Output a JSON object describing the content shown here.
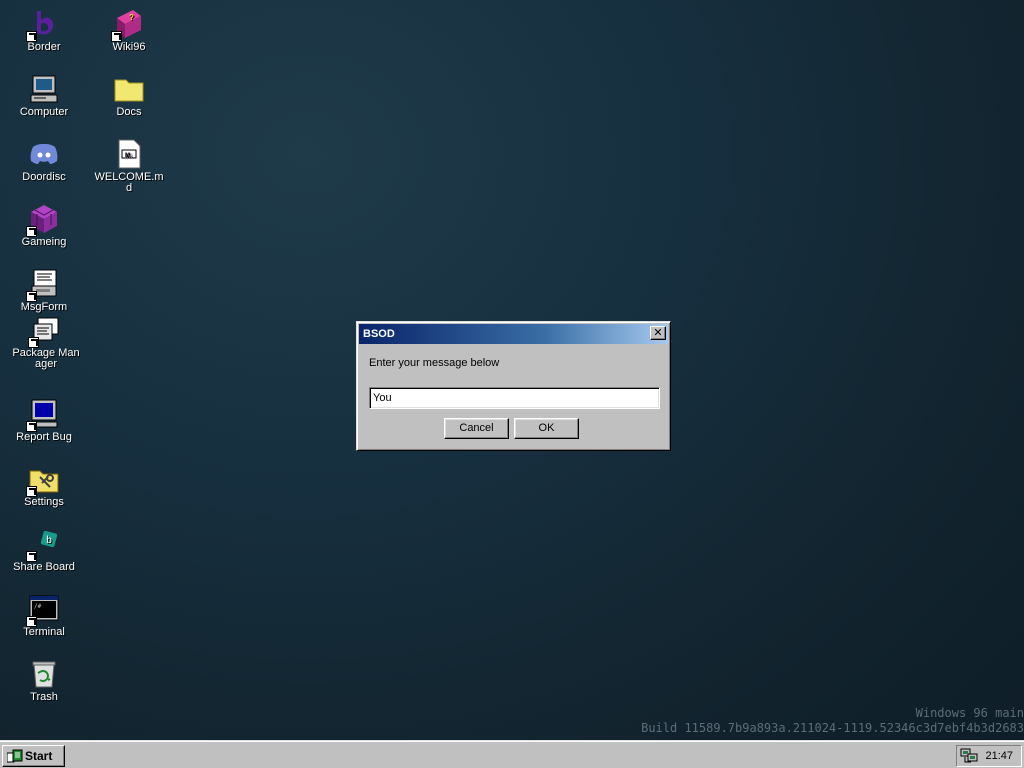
{
  "desktop": {
    "icons": [
      {
        "label": "Border",
        "icon": "border-b-icon"
      },
      {
        "label": "Wiki96",
        "icon": "book-icon"
      },
      {
        "label": "Computer",
        "icon": "computer-icon"
      },
      {
        "label": "Docs",
        "icon": "folder-icon"
      },
      {
        "label": "Doordisc",
        "icon": "discord-icon"
      },
      {
        "label": "WELCOME.md",
        "icon": "markdown-file-icon"
      },
      {
        "label": "Gameing",
        "icon": "game-cube-icon"
      },
      {
        "label": "MsgForm",
        "icon": "form-icon"
      },
      {
        "label": "Package Manager",
        "icon": "package-icon"
      },
      {
        "label": "Report Bug",
        "icon": "monitor-icon"
      },
      {
        "label": "Settings",
        "icon": "settings-folder-icon"
      },
      {
        "label": "Share Board",
        "icon": "share-board-icon"
      },
      {
        "label": "Terminal",
        "icon": "terminal-icon"
      },
      {
        "label": "Trash",
        "icon": "recycle-bin-icon"
      }
    ]
  },
  "dialog": {
    "title": "BSOD",
    "close_label": "✕",
    "prompt": "Enter your message below",
    "input_value": "You ",
    "cancel_label": "Cancel",
    "ok_label": "OK"
  },
  "watermark": {
    "line1": "Windows 96 main",
    "line2": "Build 11589.7b9a893a.211024-1119.52346c3d7ebf4b3d2683"
  },
  "taskbar": {
    "start_label": "Start",
    "clock": "21:47"
  },
  "colors": {
    "desktop_bg": "#173040",
    "titlebar_start": "#0a246a",
    "titlebar_end": "#a6caf0",
    "chrome": "#c0c0c0"
  }
}
